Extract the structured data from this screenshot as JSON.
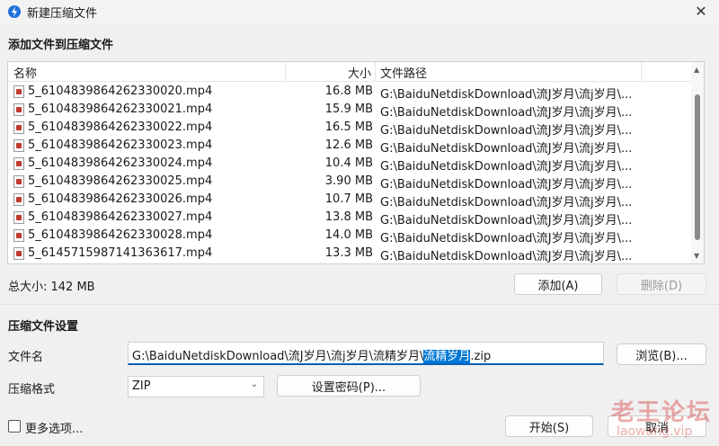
{
  "window": {
    "title": "新建压缩文件",
    "close_icon": "close-icon"
  },
  "add_section": {
    "title": "添加文件到压缩文件",
    "columns": [
      "名称",
      "大小",
      "文件路径"
    ],
    "rows": [
      {
        "name": "5_6104839864262330020.mp4",
        "size": "16.8 MB",
        "path": "G:\\BaiduNetdiskDownload\\流J岁月\\流j岁月\\..."
      },
      {
        "name": "5_6104839864262330021.mp4",
        "size": "15.9 MB",
        "path": "G:\\BaiduNetdiskDownload\\流J岁月\\流j岁月\\..."
      },
      {
        "name": "5_6104839864262330022.mp4",
        "size": "16.5 MB",
        "path": "G:\\BaiduNetdiskDownload\\流J岁月\\流j岁月\\..."
      },
      {
        "name": "5_6104839864262330023.mp4",
        "size": "12.6 MB",
        "path": "G:\\BaiduNetdiskDownload\\流J岁月\\流j岁月\\..."
      },
      {
        "name": "5_6104839864262330024.mp4",
        "size": "10.4 MB",
        "path": "G:\\BaiduNetdiskDownload\\流J岁月\\流j岁月\\..."
      },
      {
        "name": "5_6104839864262330025.mp4",
        "size": "3.90 MB",
        "path": "G:\\BaiduNetdiskDownload\\流J岁月\\流j岁月\\..."
      },
      {
        "name": "5_6104839864262330026.mp4",
        "size": "10.7 MB",
        "path": "G:\\BaiduNetdiskDownload\\流J岁月\\流j岁月\\..."
      },
      {
        "name": "5_6104839864262330027.mp4",
        "size": "13.8 MB",
        "path": "G:\\BaiduNetdiskDownload\\流J岁月\\流j岁月\\..."
      },
      {
        "name": "5_6104839864262330028.mp4",
        "size": "14.0 MB",
        "path": "G:\\BaiduNetdiskDownload\\流J岁月\\流j岁月\\..."
      },
      {
        "name": "5_6145715987141363617.mp4",
        "size": "13.3 MB",
        "path": "G:\\BaiduNetdiskDownload\\流J岁月\\流j岁月\\..."
      }
    ],
    "total_size": "总大小: 142 MB",
    "add_button": "添加(A)",
    "delete_button": "删除(D)"
  },
  "settings_section": {
    "title": "压缩文件设置",
    "filename_label": "文件名",
    "filename_prefix": "G:\\BaiduNetdiskDownload\\流J岁月\\流j岁月\\流精岁月\\",
    "filename_selected": "流精岁月",
    "filename_suffix": ".zip",
    "browse_button": "浏览(B)...",
    "format_label": "压缩格式",
    "format_value": "ZIP",
    "password_button": "设置密码(P)..."
  },
  "footer": {
    "more_options": "更多选项...",
    "more_options_checked": false,
    "start_button": "开始(S)",
    "cancel_button": "取消"
  },
  "watermark": {
    "cn": "老王论坛",
    "en": "laowang.vip"
  },
  "colors": {
    "accent": "#0078d7",
    "scroll_thumb": "#8a8a8a",
    "watermark": "#d84a4a"
  }
}
